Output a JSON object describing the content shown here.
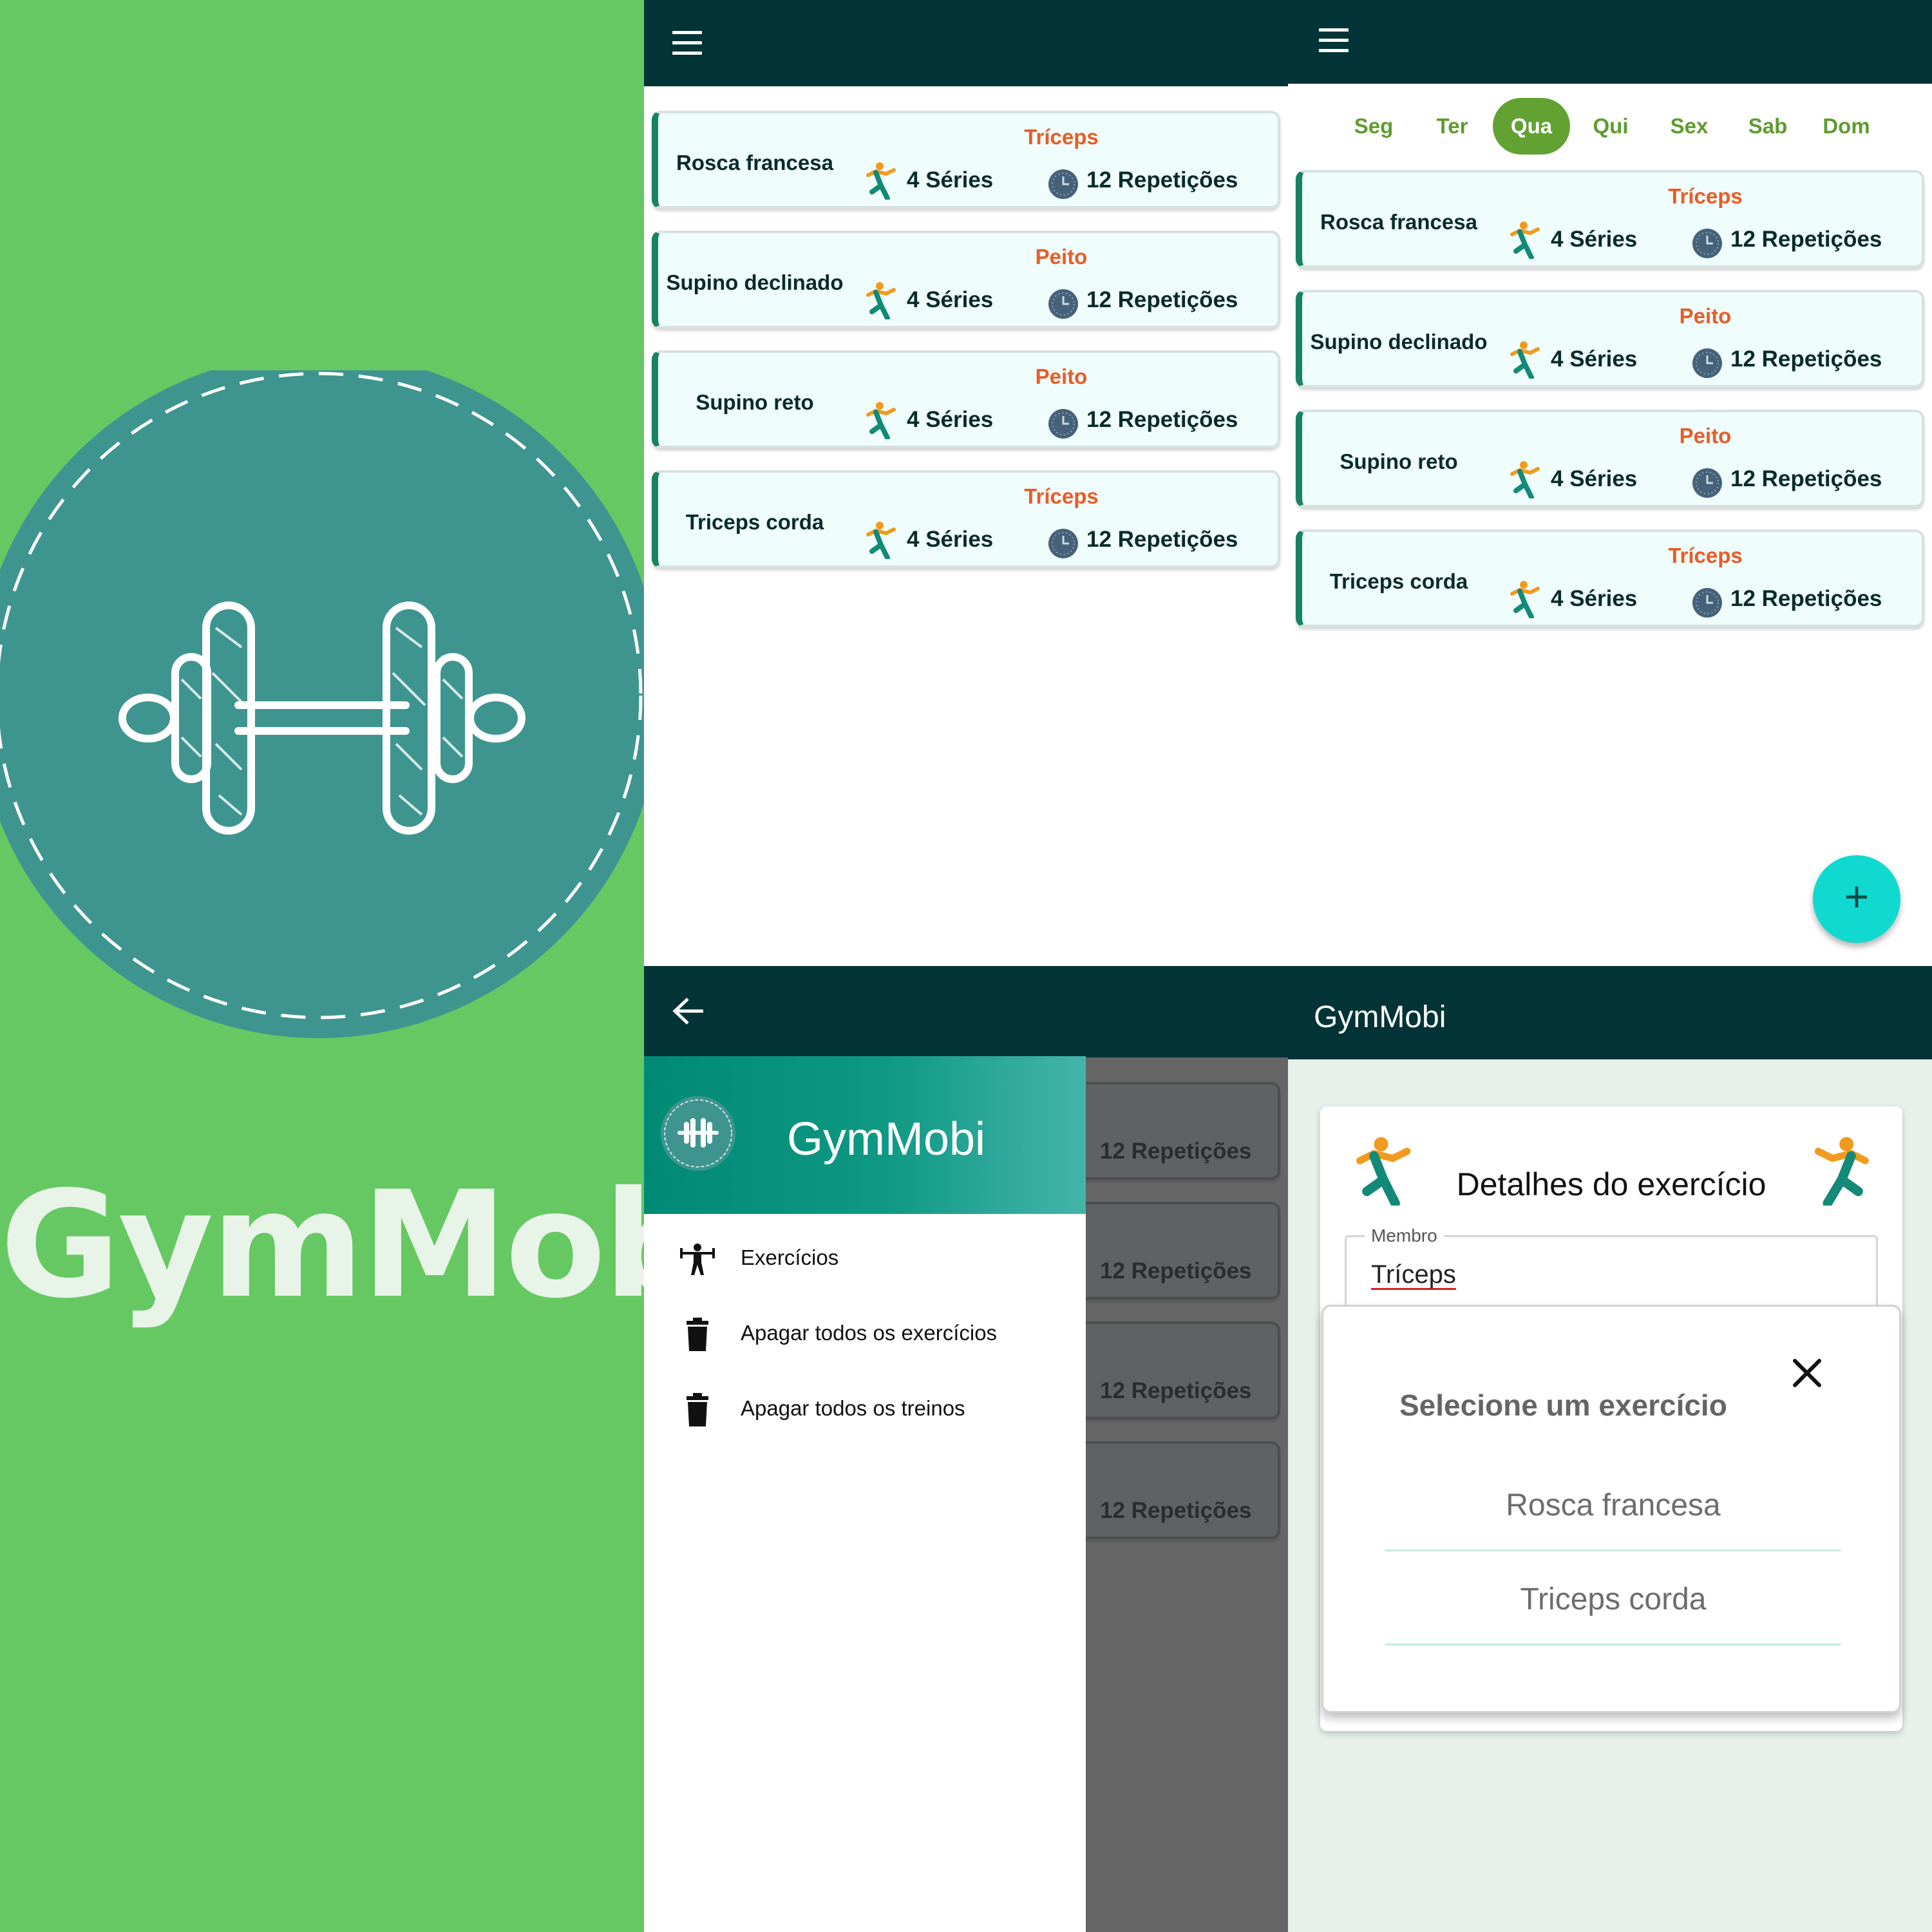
{
  "promo": {
    "app_name": "GymMobi",
    "colors": {
      "background": "#66c863",
      "logo_circle": "#3e9590",
      "title": "#e8f4e7"
    }
  },
  "colors": {
    "appbar": "#023336",
    "card_border": "#178360",
    "muscle": "#ec5b24",
    "day_active": "#62a232",
    "fab": "#10d9cf"
  },
  "workout_list": {
    "menu_icon": "hamburger-menu-icon",
    "items": [
      {
        "muscle": "Tríceps",
        "name": "Rosca francesa",
        "series": "4 Séries",
        "reps": "12 Repetições"
      },
      {
        "muscle": "Peito",
        "name": "Supino declinado",
        "series": "4 Séries",
        "reps": "12 Repetições"
      },
      {
        "muscle": "Peito",
        "name": "Supino reto",
        "series": "4 Séries",
        "reps": "12 Repetições"
      },
      {
        "muscle": "Tríceps",
        "name": "Triceps corda",
        "series": "4 Séries",
        "reps": "12 Repetições"
      }
    ]
  },
  "weekly": {
    "days": [
      "Seg",
      "Ter",
      "Qua",
      "Qui",
      "Sex",
      "Sab",
      "Dom"
    ],
    "selected_day": "Qua",
    "items": [
      {
        "muscle": "Tríceps",
        "name": "Rosca francesa",
        "series": "4 Séries",
        "reps": "12 Repetições"
      },
      {
        "muscle": "Peito",
        "name": "Supino declinado",
        "series": "4 Séries",
        "reps": "12 Repetições"
      },
      {
        "muscle": "Peito",
        "name": "Supino reto",
        "series": "4 Séries",
        "reps": "12 Repetições"
      },
      {
        "muscle": "Tríceps",
        "name": "Triceps corda",
        "series": "4 Séries",
        "reps": "12 Repetições"
      }
    ],
    "fab_label": "+"
  },
  "drawer": {
    "back_icon": "arrow-back-icon",
    "title": "GymMobi",
    "menu": [
      {
        "label": "Exercícios",
        "icon": "weightlifter-icon"
      },
      {
        "label": "Apagar todos os exercícios",
        "icon": "trash-icon"
      },
      {
        "label": "Apagar todos os treinos",
        "icon": "trash-icon"
      }
    ],
    "background_reps": [
      "12 Repetições",
      "12 Repetições",
      "12 Repetições",
      "12 Repetições"
    ]
  },
  "details": {
    "app_title": "GymMobi",
    "card_title": "Detalhes do exercício",
    "field_label": "Membro",
    "field_value": "Tríceps",
    "modal": {
      "title": "Selecione um exercício",
      "close_icon": "close-icon",
      "options": [
        "Rosca francesa",
        "Triceps corda"
      ]
    }
  }
}
